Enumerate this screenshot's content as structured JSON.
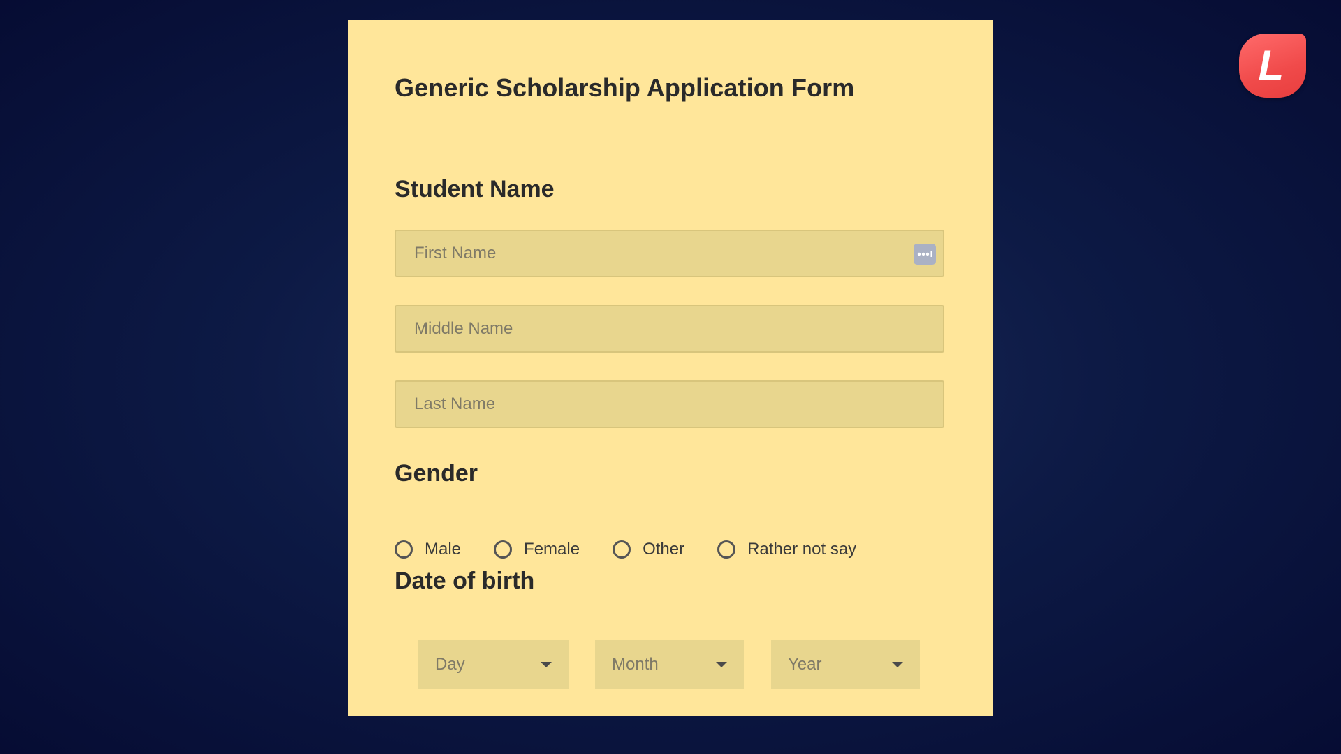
{
  "form": {
    "title": "Generic Scholarship Application Form",
    "student_name": {
      "label": "Student Name",
      "first_name_placeholder": "First Name",
      "middle_name_placeholder": "Middle Name",
      "last_name_placeholder": "Last Name"
    },
    "gender": {
      "label": "Gender",
      "options": [
        "Male",
        "Female",
        "Other",
        "Rather not say"
      ]
    },
    "dob": {
      "label": "Date of birth",
      "day_placeholder": "Day",
      "month_placeholder": "Month",
      "year_placeholder": "Year"
    }
  },
  "icons": {
    "autofill": "autofill-dots-icon",
    "caret": "caret-down-icon"
  },
  "brand": {
    "letter": "L"
  },
  "colors": {
    "card_background": "#ffe69a",
    "input_background": "#e8d68e",
    "page_background": "#0d1a45",
    "brand_accent": "#f04a4a"
  }
}
